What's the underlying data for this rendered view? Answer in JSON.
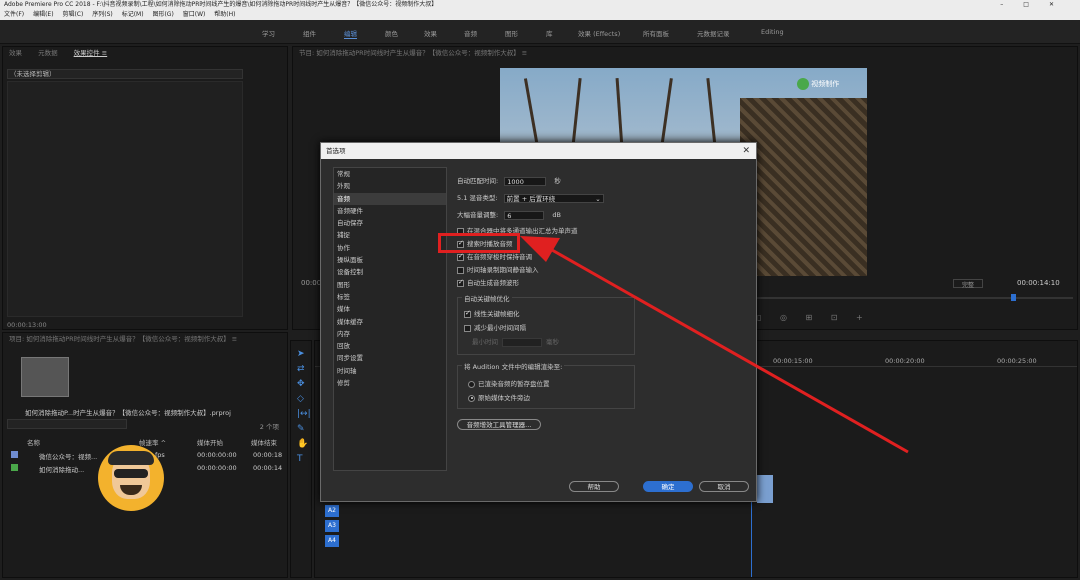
{
  "window": {
    "title": "Adobe Premiere Pro CC 2018 - F:\\抖音视频录制\\工程\\如何消除拖动PR时间线产生的爆音\\如何消除拖动PR时间线时产生从爆音？【微信公众号：视频制作大叔】"
  },
  "menu": [
    "文件(F)",
    "编辑(E)",
    "剪辑(C)",
    "序列(S)",
    "标记(M)",
    "图形(G)",
    "窗口(W)",
    "帮助(H)"
  ],
  "workspaces": [
    {
      "label": "学习"
    },
    {
      "label": "组件"
    },
    {
      "label": "编辑",
      "active": true
    },
    {
      "label": "颜色"
    },
    {
      "label": "效果"
    },
    {
      "label": "音频"
    },
    {
      "label": "图形"
    },
    {
      "label": "库"
    },
    {
      "label": "效果 (Effects)"
    },
    {
      "label": "所有面板"
    },
    {
      "label": "元数据记录"
    },
    {
      "label": "Editing"
    }
  ],
  "source_panel": {
    "tabs": [
      "效果",
      "元数据",
      "效果控件 ≡"
    ],
    "no_clip": "（未选择剪辑）",
    "timecode": "00:00:13:00"
  },
  "program_panel": {
    "title": "节目: 如何消除拖动PR时间线时产生从爆音？【微信公众号：视频制作大叔】 ≡",
    "timecode_left": "00:00",
    "fit": "完整",
    "timecode_right": "00:00:14:10",
    "watermark": "视频制作"
  },
  "project_panel": {
    "title": "项目: 如何消除拖动PR时间线时产生从爆音？【微信公众号：视频制作大叔】 ≡",
    "project_file": "如何消除拖动P...时产生从爆音？【微信公众号：视频制作大叔】.prproj",
    "item_count": "2 个项",
    "columns": [
      "名称",
      "帧速率 ^",
      "媒体开始",
      "媒体结束"
    ],
    "rows": [
      {
        "name": "微信公众号：视频...",
        "fps": "fps",
        "start": "00:00:00:00",
        "end": "00:00:18",
        "color": "#6f8ccf"
      },
      {
        "name": "如何消除拖动...",
        "fps": "",
        "start": "00:00:00:00",
        "end": "00:00:14",
        "color": "#4aa84a"
      }
    ]
  },
  "timeline": {
    "ruler": [
      "00:00:15:00",
      "00:00:20:00",
      "00:00:25:00"
    ],
    "tracks": [
      "A2",
      "A3",
      "A4"
    ]
  },
  "dialog": {
    "title": "首选项",
    "categories": [
      {
        "label": "常规"
      },
      {
        "label": "外观"
      },
      {
        "label": "音频",
        "selected": true
      },
      {
        "label": "音频硬件"
      },
      {
        "label": "自动保存"
      },
      {
        "label": "捕捉"
      },
      {
        "label": "协作"
      },
      {
        "label": "操纵面板"
      },
      {
        "label": "设备控制"
      },
      {
        "label": "图形"
      },
      {
        "label": "标签"
      },
      {
        "label": "媒体"
      },
      {
        "label": "媒体缓存"
      },
      {
        "label": "内存"
      },
      {
        "label": "回放"
      },
      {
        "label": "同步设置"
      },
      {
        "label": "时间轴"
      },
      {
        "label": "修剪"
      }
    ],
    "audio": {
      "auto_match_label": "自动匹配时间:",
      "auto_match_value": "1000",
      "auto_match_unit": "秒",
      "mix_type_label": "5.1 混音类型:",
      "mix_type_value": "前置 + 后置环绕",
      "gain_label": "大幅音量调整:",
      "gain_value": "6",
      "gain_unit": "dB",
      "opt_mono": "在混合器中将多通道输出汇总为单声道",
      "opt_scrub": "搜索时播放音频",
      "opt_mute": "在音频穿梭时保持音调",
      "opt_timeline_mute": "时间轴录制期间静音输入",
      "opt_waveform": "自动生成音频波形",
      "keyframe_group": "自动关键帧优化",
      "opt_linear": "线性关键帧细化",
      "opt_min_interval": "减少最小时间间隔",
      "min_interval_label": "最小时间",
      "min_interval_unit": "毫秒",
      "audition_group": "将 Audition 文件中的编辑渲染至:",
      "radio_preview": "已渲染音频的暂存盘位置",
      "radio_source": "原始媒体文件旁边",
      "plugin_manager": "音频增效工具管理器..."
    },
    "buttons": {
      "help": "帮助",
      "ok": "确定",
      "cancel": "取消"
    }
  }
}
